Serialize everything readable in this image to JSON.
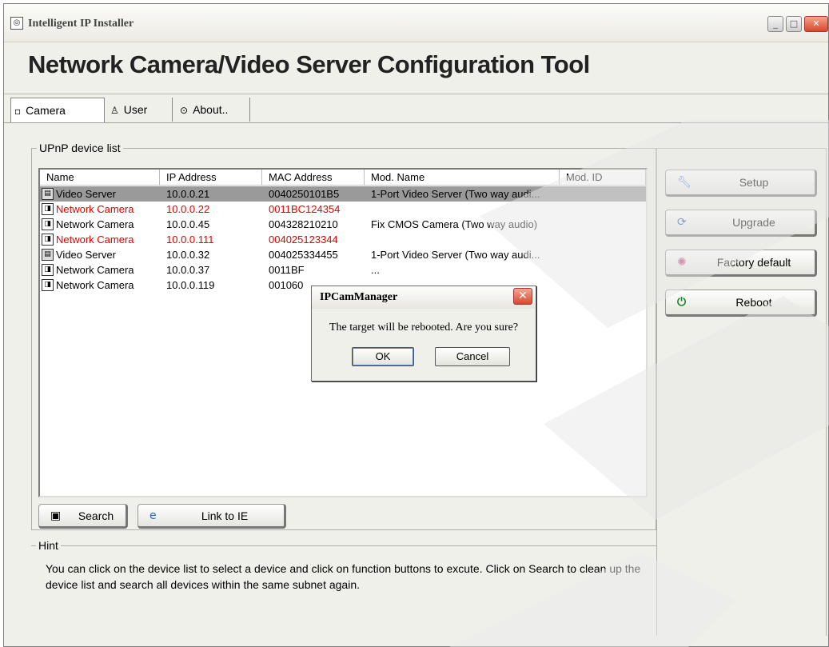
{
  "window": {
    "title": "Intelligent IP Installer",
    "headline": "Network Camera/Video Server Configuration Tool"
  },
  "tabs": [
    {
      "label": "Camera",
      "icon": "camera-icon",
      "selected": true
    },
    {
      "label": "User",
      "icon": "user-icon",
      "selected": false
    },
    {
      "label": "About..",
      "icon": "info-icon",
      "selected": false
    }
  ],
  "device_list": {
    "legend": "UPnP device list",
    "columns": [
      "Name",
      "IP Address",
      "MAC Address",
      "Mod. Name",
      "Mod. ID"
    ],
    "rows": [
      {
        "name": "Video Server",
        "ip": "10.0.0.21",
        "mac": "0040250101B5",
        "mod_name": "1-Port Video Server (Two way audi...",
        "mod_id": "",
        "type": "server",
        "selected": true,
        "highlight": false
      },
      {
        "name": "Network Camera",
        "ip": "10.0.0.22",
        "mac": "0011BC124354",
        "mod_name": "",
        "mod_id": "",
        "type": "camera",
        "selected": false,
        "highlight": true
      },
      {
        "name": "Network Camera",
        "ip": "10.0.0.45",
        "mac": "004328210210",
        "mod_name": "Fix CMOS Camera (Two way audio)",
        "mod_id": "",
        "type": "camera",
        "selected": false,
        "highlight": false
      },
      {
        "name": "Network Camera",
        "ip": "10.0.0.111",
        "mac": "004025123344",
        "mod_name": "",
        "mod_id": "",
        "type": "camera",
        "selected": false,
        "highlight": true
      },
      {
        "name": "Video Server",
        "ip": "10.0.0.32",
        "mac": "004025334455",
        "mod_name": "1-Port Video Server (Two way audi...",
        "mod_id": "",
        "type": "server",
        "selected": false,
        "highlight": false
      },
      {
        "name": "Network Camera",
        "ip": "10.0.0.37",
        "mac": "0011BF",
        "mod_name": "...",
        "mod_id": "",
        "type": "camera",
        "selected": false,
        "highlight": false
      },
      {
        "name": "Network Camera",
        "ip": "10.0.0.119",
        "mac": "001060",
        "mod_name": "...",
        "mod_id": "",
        "type": "camera",
        "selected": false,
        "highlight": false
      }
    ]
  },
  "buttons": {
    "search": "Search",
    "link_ie": "Link to IE",
    "setup": "Setup",
    "upgrade": "Upgrade",
    "factory_default": "Factory default",
    "reboot": "Reboot"
  },
  "hint": {
    "legend": "Hint",
    "text": "You can click on the device list to select a device and click on function buttons to excute. Click on Search to clean up the device list and search all devices  within the same subnet again."
  },
  "dialog": {
    "title": "IPCamManager",
    "message": "The target will be rebooted. Are you sure?",
    "ok": "OK",
    "cancel": "Cancel"
  },
  "colors": {
    "highlight_text": "#e00000",
    "selected_row": "#9a9a9a",
    "window_bg": "#f0f0ea"
  }
}
